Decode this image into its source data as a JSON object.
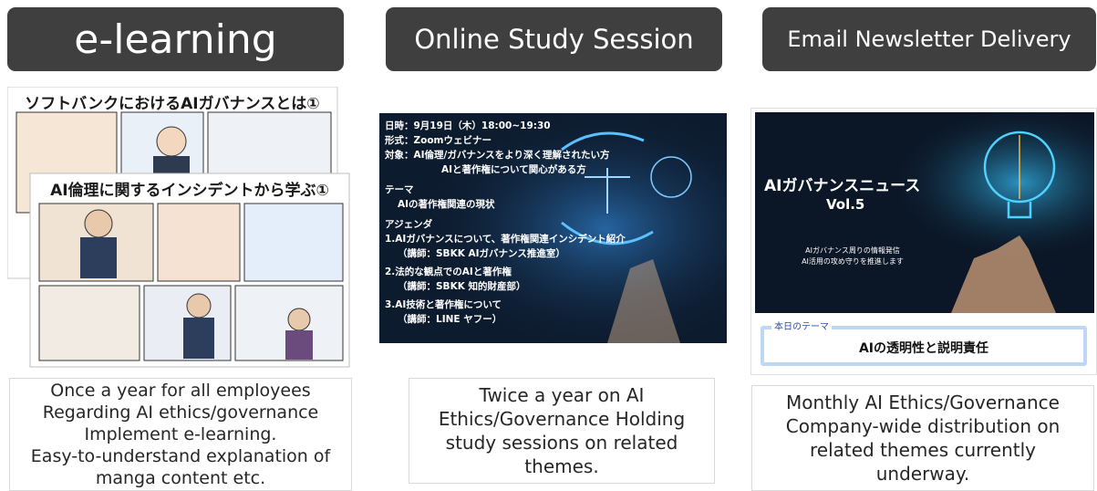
{
  "columns": [
    {
      "title": "e-learning",
      "description": "Once a year for all employees\nRegarding AI ethics/governance\nImplement e-learning.\nEasy-to-understand explanation of\nmanga content etc.",
      "image": {
        "top_title": "ソフトバンクにおけるAIガバナンスとは①",
        "bottom_title": "AI倫理に関するインシデントから学ぶ①"
      }
    },
    {
      "title": "Online Study Session",
      "description": "Twice a year on AI\nEthics/Governance Holding\nstudy sessions on related\nthemes.",
      "image": {
        "lines": [
          "日時：9月19日（木）18:00~19:30",
          "形式：Zoomウェビナー",
          "対象：AI倫理/ガバナンスをより深く理解されたい方",
          "AIと著作権について関心がある方",
          "テーマ",
          "AIの著作権関連の現状",
          "アジェンダ",
          "1.AIガバナンスについて、著作権関連インシデント紹介",
          "（講師：SBKK AIガバナンス推進室）",
          "2.法的な観点でのAIと著作権",
          "（講師：SBKK 知的財産部）",
          "3.AI技術と著作権について",
          "（講師：LINE ヤフー）"
        ]
      }
    },
    {
      "title": "Email Newsletter Delivery",
      "description": "Monthly AI Ethics/Governance\nCompany-wide distribution on\nrelated themes currently\nunderway.",
      "image": {
        "heading": "AIガバナンスニュース",
        "volume": "Vol.5",
        "sub1": "AIガバナンス周りの情報発信",
        "sub2": "AI活用の攻め守りを推進します",
        "theme_label": "本日のテーマ",
        "theme": "AIの透明性と説明責任"
      }
    }
  ],
  "colors": {
    "header_bg": "#3f3f3f",
    "panel_dark": "#0d1b2e",
    "accent_blue": "#2a6fd6"
  }
}
